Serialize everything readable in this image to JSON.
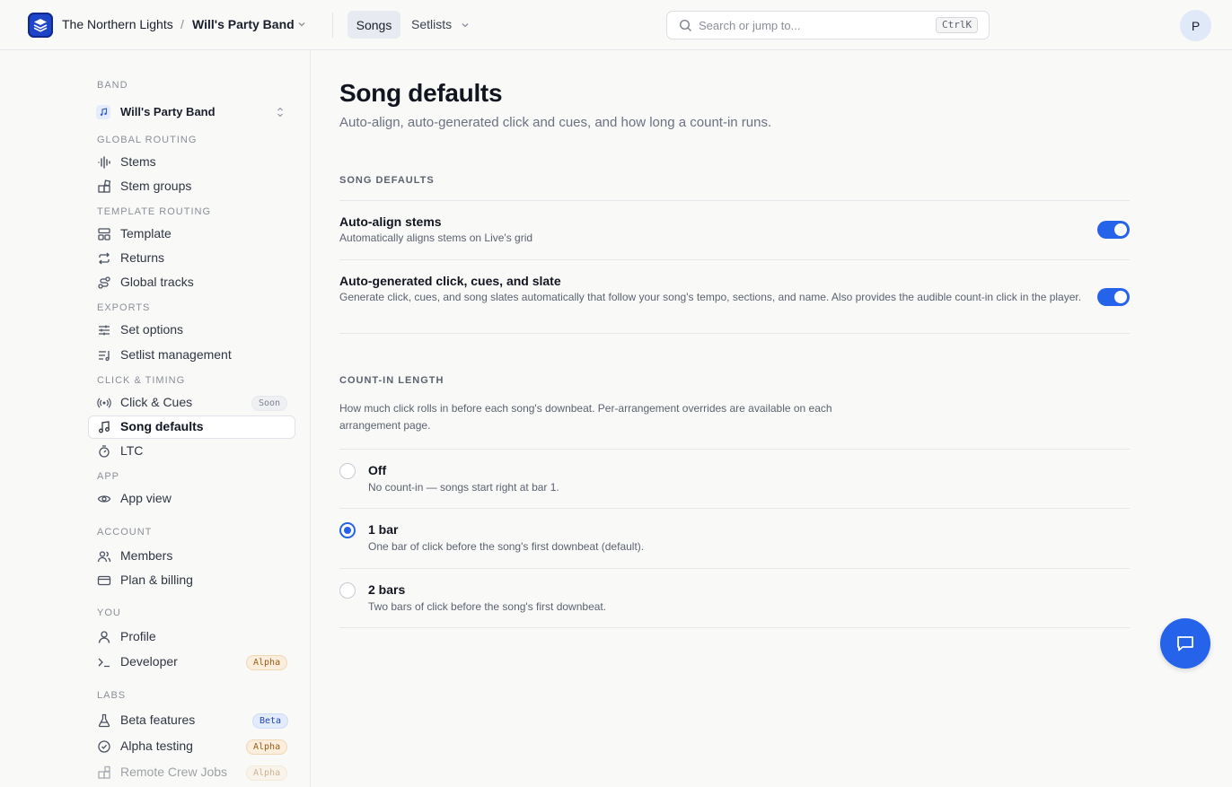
{
  "header": {
    "org_name": "The Northern Lights",
    "separator": "/",
    "band_name": "Will's Party Band",
    "nav": {
      "songs": "Songs",
      "setlists": "Setlists"
    },
    "search": {
      "placeholder": "Search or jump to...",
      "shortcut": "CtrlK"
    },
    "avatar_initial": "P"
  },
  "sidebar": {
    "band_label": "BAND",
    "band_selector": "Will's Party Band",
    "sections": {
      "global_routing": "GLOBAL ROUTING",
      "template_routing": "TEMPLATE ROUTING",
      "exports": "EXPORTS",
      "click_timing": "CLICK & TIMING",
      "app": "APP",
      "account": "ACCOUNT",
      "you": "YOU",
      "labs": "LABS"
    },
    "items": {
      "stems": "Stems",
      "stem_groups": "Stem groups",
      "template": "Template",
      "returns": "Returns",
      "global_tracks": "Global tracks",
      "set_options": "Set options",
      "setlist_management": "Setlist management",
      "click_cues": "Click & Cues",
      "song_defaults": "Song defaults",
      "ltc": "LTC",
      "app_view": "App view",
      "members": "Members",
      "plan_billing": "Plan & billing",
      "profile": "Profile",
      "developer": "Developer",
      "beta_features": "Beta features",
      "alpha_testing": "Alpha testing",
      "remote_crew_jobs": "Remote Crew Jobs"
    },
    "badges": {
      "soon": "Soon",
      "alpha": "Alpha",
      "beta": "Beta"
    }
  },
  "main": {
    "title": "Song defaults",
    "subtitle": "Auto-align, auto-generated click and cues, and how long a count-in runs.",
    "song_defaults_heading": "SONG DEFAULTS",
    "settings": [
      {
        "title": "Auto-align stems",
        "description": "Automatically aligns stems on Live's grid",
        "enabled": true
      },
      {
        "title": "Auto-generated click, cues, and slate",
        "description": "Generate click, cues, and song slates automatically that follow your song's tempo, sections, and name. Also provides the audible count-in click in the player.",
        "enabled": true
      }
    ],
    "count_in": {
      "heading": "COUNT-IN LENGTH",
      "description": "How much click rolls in before each song's downbeat. Per-arrangement overrides are available on each arrangement page.",
      "options": [
        {
          "label": "Off",
          "description": "No count-in — songs start right at bar 1.",
          "selected": false
        },
        {
          "label": "1 bar",
          "description": "One bar of click before the song's first downbeat (default).",
          "selected": true
        },
        {
          "label": "2 bars",
          "description": "Two bars of click before the song's first downbeat.",
          "selected": false
        }
      ]
    }
  },
  "colors": {
    "accent": "#2563eb",
    "logo": "#1e45c8"
  }
}
